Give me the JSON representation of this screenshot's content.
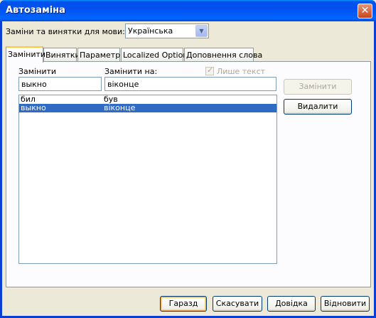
{
  "window": {
    "title": "Автозаміна",
    "close_glyph": "✕"
  },
  "language": {
    "label": "Заміни та винятки для мови:",
    "selected": "Українська"
  },
  "tabs": [
    {
      "label": "Замінити",
      "active": true
    },
    {
      "label": "Винятки",
      "active": false
    },
    {
      "label": "Параметри",
      "active": false
    },
    {
      "label": "Localized Options",
      "active": false
    },
    {
      "label": "Доповнення слова",
      "active": false
    }
  ],
  "replace": {
    "replace_label": "Замінити",
    "with_label": "Замінити на:",
    "replace_value": "выкно",
    "with_value": "віконце",
    "plain_text_label": "Лише текст",
    "plain_text_checked": true
  },
  "entries": [
    {
      "from": "бил",
      "to": "був",
      "selected": false
    },
    {
      "from": "выкно",
      "to": "віконце",
      "selected": true
    }
  ],
  "side_buttons": {
    "replace": "Замінити",
    "delete": "Видалити"
  },
  "footer": {
    "ok": "Гаразд",
    "cancel": "Скасувати",
    "help": "Довідка",
    "restore": "Відновити"
  },
  "colors": {
    "titlebar": "#0054e3",
    "selection": "#316ac5",
    "dialog_bg": "#ece9d8"
  }
}
